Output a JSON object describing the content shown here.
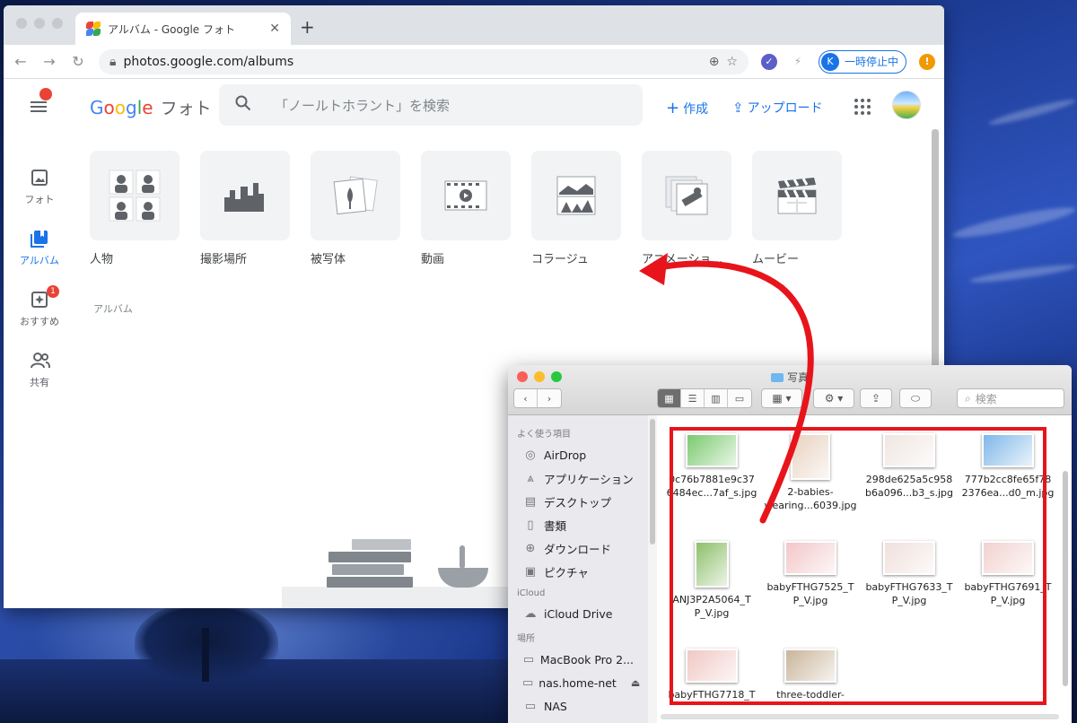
{
  "browser": {
    "tab_title": "アルバム - Google フォト",
    "url": "photos.google.com/albums",
    "profile_initial": "K",
    "profile_status": "一時停止中",
    "alert_glyph": "!"
  },
  "photos": {
    "logo_google": [
      "G",
      "o",
      "o",
      "g",
      "l",
      "e"
    ],
    "logo_product": "フォト",
    "search_placeholder": "「ノールトホラント」を検索",
    "create_label": "作成",
    "upload_label": "アップロード",
    "nav": [
      {
        "label": "フォト",
        "icon": "photo-icon"
      },
      {
        "label": "アルバム",
        "icon": "album-icon",
        "active": true
      },
      {
        "label": "おすすめ",
        "icon": "suggestions-icon",
        "badge": "1"
      },
      {
        "label": "共有",
        "icon": "people-icon"
      }
    ],
    "categories": [
      {
        "label": "人物",
        "icon": "people-faces-icon"
      },
      {
        "label": "撮影場所",
        "icon": "places-icon"
      },
      {
        "label": "被写体",
        "icon": "things-icon"
      },
      {
        "label": "動画",
        "icon": "video-icon"
      },
      {
        "label": "コラージュ",
        "icon": "collage-icon"
      },
      {
        "label": "アニメーショ…",
        "icon": "animation-icon"
      },
      {
        "label": "ムービー",
        "icon": "movie-icon"
      }
    ],
    "section_label": "アルバム"
  },
  "finder": {
    "title": "写真",
    "search_placeholder": "検索",
    "sidebar": [
      {
        "type": "section",
        "label": "よく使う項目"
      },
      {
        "type": "item",
        "label": "AirDrop",
        "icon": "airdrop-icon"
      },
      {
        "type": "item",
        "label": "アプリケーション",
        "icon": "applications-icon"
      },
      {
        "type": "item",
        "label": "デスクトップ",
        "icon": "desktop-icon"
      },
      {
        "type": "item",
        "label": "書類",
        "icon": "documents-icon"
      },
      {
        "type": "item",
        "label": "ダウンロード",
        "icon": "downloads-icon"
      },
      {
        "type": "item",
        "label": "ピクチャ",
        "icon": "pictures-icon"
      },
      {
        "type": "section",
        "label": "iCloud"
      },
      {
        "type": "item",
        "label": "iCloud Drive",
        "icon": "cloud-icon"
      },
      {
        "type": "section",
        "label": "場所"
      },
      {
        "type": "item",
        "label": "MacBook Pro 2...",
        "icon": "laptop-icon"
      },
      {
        "type": "item",
        "label": "nas.home-net",
        "icon": "server-icon",
        "eject": true
      },
      {
        "type": "item",
        "label": "NAS",
        "icon": "server-icon"
      }
    ],
    "files": [
      {
        "line1": "0c76b7881e9c37",
        "line2": "6484ec...7af_s.jpg",
        "thumb": "#7bc96f",
        "w": 58,
        "h": 38
      },
      {
        "line1": "2-babies-",
        "line2": "wearing...6039.jpg",
        "thumb": "#e8d2c0",
        "w": 44,
        "h": 52
      },
      {
        "line1": "298de625a5c958",
        "line2": "b6a096...b3_s.jpg",
        "thumb": "#efe6e2",
        "w": 58,
        "h": 38
      },
      {
        "line1": "777b2cc8fe65f78",
        "line2": "2376ea...d0_m.jpg",
        "thumb": "#7fb7e8",
        "w": 58,
        "h": 38
      },
      {
        "line1": "ANJ3P2A5064_T",
        "line2": "P_V.jpg",
        "thumb": "#8dbf6a",
        "w": 38,
        "h": 52
      },
      {
        "line1": "babyFTHG7525_T",
        "line2": "P_V.jpg",
        "thumb": "#f3c7c9",
        "w": 58,
        "h": 38
      },
      {
        "line1": "babyFTHG7633_T",
        "line2": "P_V.jpg",
        "thumb": "#f0e0dc",
        "w": 58,
        "h": 38
      },
      {
        "line1": "babyFTHG7691_T",
        "line2": "P_V.jpg",
        "thumb": "#f1d2cf",
        "w": 58,
        "h": 38
      },
      {
        "line1": "babyFTHG7718_T",
        "line2": "",
        "thumb": "#f0c8c4",
        "w": 58,
        "h": 38
      },
      {
        "line1": "three-toddler-",
        "line2": "",
        "thumb": "#c9b59a",
        "w": 58,
        "h": 38
      }
    ]
  },
  "colors": {
    "annotation_red": "#e8141b",
    "accent_blue": "#1a73e8"
  }
}
